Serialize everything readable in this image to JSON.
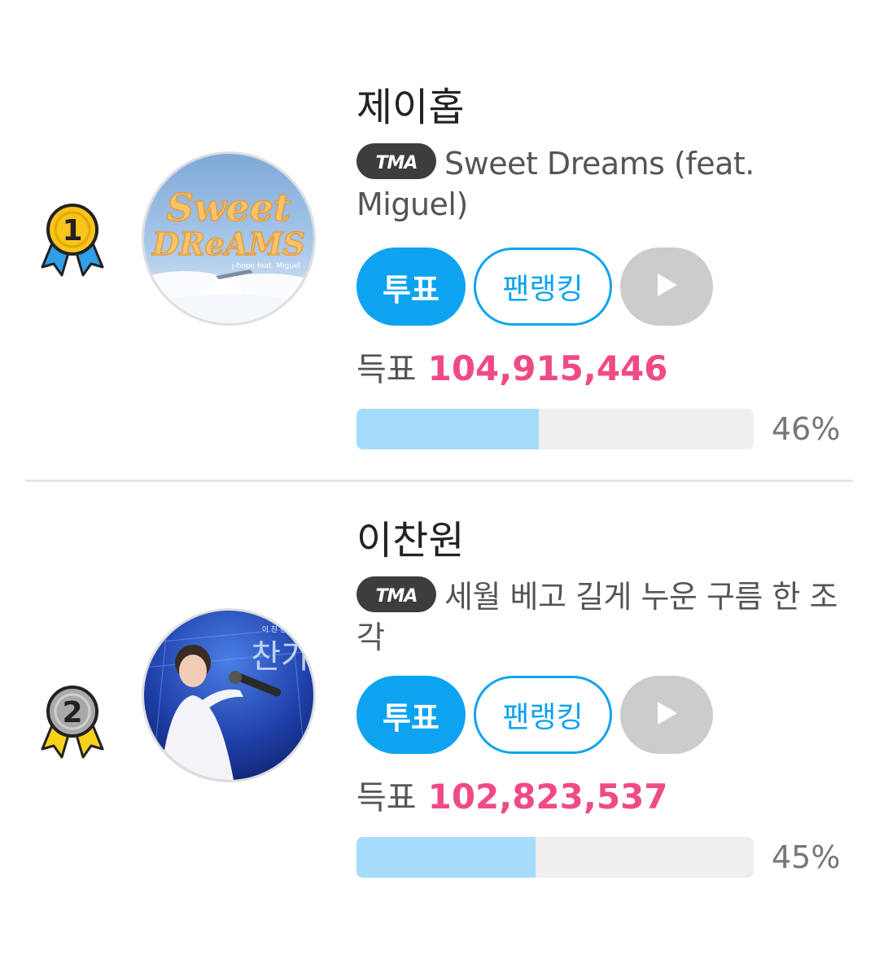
{
  "entries": [
    {
      "rank": "1",
      "artist": "제이홉",
      "badge": "TMA",
      "song": "Sweet Dreams (feat. Miguel)",
      "album_cover_text": {
        "line1": "Sweet",
        "line2": "DReAMS",
        "credit": "j-hope feat. Miguel"
      },
      "vote_label": "투표",
      "fanranking_label": "팬랭킹",
      "play_icon": "play-icon",
      "votes_label": "득표",
      "votes": "104,915,446",
      "percent_label": "46%",
      "percent": 46,
      "medal_ribbon_color": "#2f9fe8"
    },
    {
      "rank": "2",
      "artist": "이찬원",
      "badge": "TMA",
      "song": "세월 베고 길게 누운 구름 한 조각",
      "album_cover_text": {
        "line1": "이 찬 원",
        "line2": "찬가"
      },
      "vote_label": "투표",
      "fanranking_label": "팬랭킹",
      "play_icon": "play-icon",
      "votes_label": "득표",
      "votes": "102,823,537",
      "percent_label": "45%",
      "percent": 45,
      "medal_ribbon_color": "#f7d21b"
    }
  ],
  "colors": {
    "accent": "#0ea3f0",
    "votes": "#ef4a86",
    "progress_fill": "#a6dcfb",
    "progress_track": "#efefef",
    "play_button": "#cccccc",
    "gold": "#f8c51c",
    "silver": "#a9a9a9"
  }
}
